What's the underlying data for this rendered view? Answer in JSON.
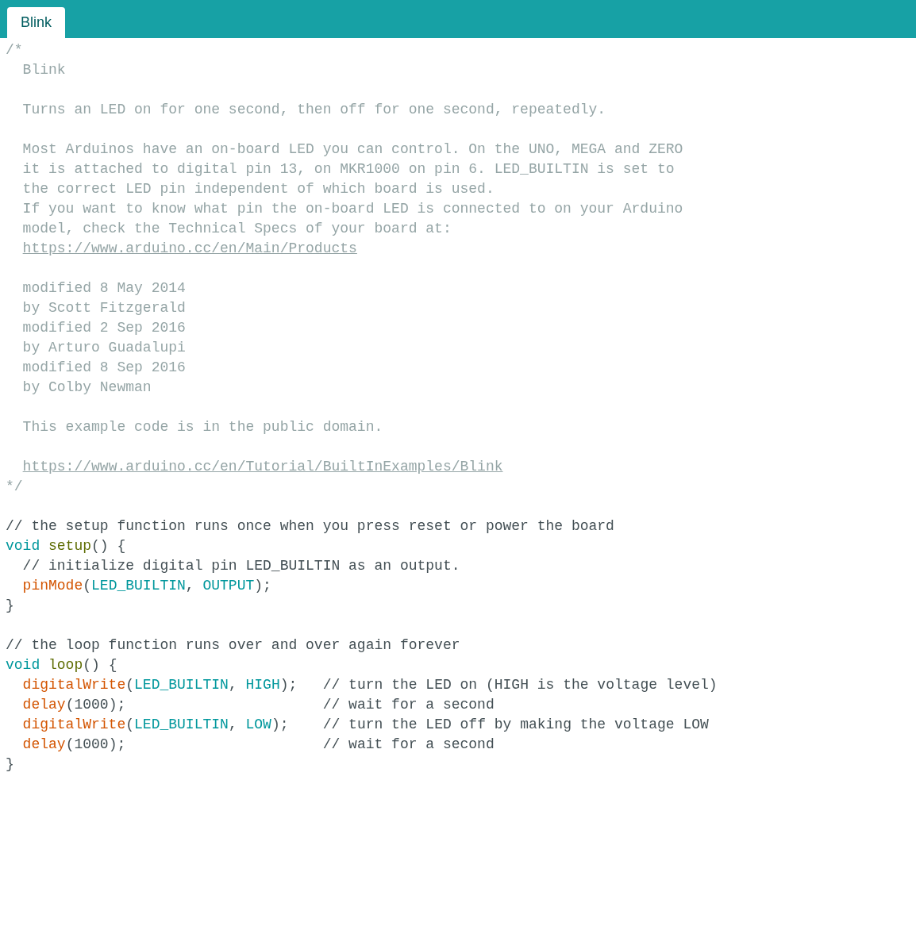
{
  "tabs": [
    {
      "label": "Blink",
      "selected": true
    }
  ],
  "editor": {
    "lines": [
      {
        "tokens": [
          {
            "kind": "block-comment",
            "text": "/*"
          }
        ]
      },
      {
        "tokens": [
          {
            "kind": "block-comment",
            "text": "  Blink"
          }
        ]
      },
      {
        "gap_before": true,
        "tokens": [
          {
            "kind": "block-comment",
            "text": "  Turns an LED on for one second, then off for one second, repeatedly."
          }
        ]
      },
      {
        "gap_before": true,
        "tokens": [
          {
            "kind": "block-comment",
            "text": "  Most Arduinos have an on-board LED you can control. On the UNO, MEGA and ZERO"
          }
        ]
      },
      {
        "tokens": [
          {
            "kind": "block-comment",
            "text": "  it is attached to digital pin 13, on MKR1000 on pin 6. LED_BUILTIN is set to"
          }
        ]
      },
      {
        "tokens": [
          {
            "kind": "block-comment",
            "text": "  the correct LED pin independent of which board is used."
          }
        ]
      },
      {
        "tokens": [
          {
            "kind": "block-comment",
            "text": "  If you want to know what pin the on-board LED is connected to on your Arduino"
          }
        ]
      },
      {
        "tokens": [
          {
            "kind": "block-comment",
            "text": "  model, check the Technical Specs of your board at:"
          }
        ]
      },
      {
        "tokens": [
          {
            "kind": "link",
            "text": "  https://www.arduino.cc/en/Main/Products"
          }
        ]
      },
      {
        "gap_before": true,
        "tokens": [
          {
            "kind": "block-comment",
            "text": "  modified 8 May 2014"
          }
        ]
      },
      {
        "tokens": [
          {
            "kind": "block-comment",
            "text": "  by Scott Fitzgerald"
          }
        ]
      },
      {
        "tokens": [
          {
            "kind": "block-comment",
            "text": "  modified 2 Sep 2016"
          }
        ]
      },
      {
        "tokens": [
          {
            "kind": "block-comment",
            "text": "  by Arturo Guadalupi"
          }
        ]
      },
      {
        "tokens": [
          {
            "kind": "block-comment",
            "text": "  modified 8 Sep 2016"
          }
        ]
      },
      {
        "tokens": [
          {
            "kind": "block-comment",
            "text": "  by Colby Newman"
          }
        ]
      },
      {
        "gap_before": true,
        "tokens": [
          {
            "kind": "block-comment",
            "text": "  This example code is in the public domain."
          }
        ]
      },
      {
        "gap_before": true,
        "tokens": [
          {
            "kind": "link",
            "text": "  https://www.arduino.cc/en/Tutorial/BuiltInExamples/Blink"
          }
        ]
      },
      {
        "tokens": [
          {
            "kind": "block-comment",
            "text": "*/"
          }
        ]
      },
      {
        "gap_before": true,
        "tokens": [
          {
            "kind": "line-comment",
            "text": "// the setup function runs once when you press reset or power the board"
          }
        ]
      },
      {
        "tokens": [
          {
            "kind": "keyword",
            "text": "void"
          },
          {
            "kind": "function",
            "text": " setup"
          },
          {
            "kind": "plain",
            "text": "() {"
          }
        ]
      },
      {
        "tokens": [
          {
            "kind": "line-comment",
            "text": "  // initialize digital pin LED_BUILTIN as an output."
          }
        ]
      },
      {
        "tokens": [
          {
            "kind": "builtin",
            "text": "  pinMode"
          },
          {
            "kind": "plain",
            "text": "("
          },
          {
            "kind": "constant",
            "text": "LED_BUILTIN"
          },
          {
            "kind": "plain",
            "text": ", "
          },
          {
            "kind": "constant",
            "text": "OUTPUT"
          },
          {
            "kind": "plain",
            "text": ");"
          }
        ]
      },
      {
        "tokens": [
          {
            "kind": "plain",
            "text": "}"
          }
        ]
      },
      {
        "gap_before": true,
        "tokens": [
          {
            "kind": "line-comment",
            "text": "// the loop function runs over and over again forever"
          }
        ]
      },
      {
        "tokens": [
          {
            "kind": "keyword",
            "text": "void"
          },
          {
            "kind": "function",
            "text": " loop"
          },
          {
            "kind": "plain",
            "text": "() {"
          }
        ]
      },
      {
        "tokens": [
          {
            "kind": "builtin",
            "text": "  digitalWrite"
          },
          {
            "kind": "plain",
            "text": "("
          },
          {
            "kind": "constant",
            "text": "LED_BUILTIN"
          },
          {
            "kind": "plain",
            "text": ", "
          },
          {
            "kind": "constant",
            "text": "HIGH"
          },
          {
            "kind": "plain",
            "text": ");"
          },
          {
            "kind": "line-comment",
            "text": "   // turn the LED on (HIGH is the voltage level)"
          }
        ]
      },
      {
        "tokens": [
          {
            "kind": "builtin",
            "text": "  delay"
          },
          {
            "kind": "plain",
            "text": "(1000);"
          },
          {
            "kind": "line-comment",
            "text": "                       // wait for a second"
          }
        ]
      },
      {
        "tokens": [
          {
            "kind": "builtin",
            "text": "  digitalWrite"
          },
          {
            "kind": "plain",
            "text": "("
          },
          {
            "kind": "constant",
            "text": "LED_BUILTIN"
          },
          {
            "kind": "plain",
            "text": ", "
          },
          {
            "kind": "constant",
            "text": "LOW"
          },
          {
            "kind": "plain",
            "text": ");"
          },
          {
            "kind": "line-comment",
            "text": "    // turn the LED off by making the voltage LOW"
          }
        ]
      },
      {
        "tokens": [
          {
            "kind": "builtin",
            "text": "  delay"
          },
          {
            "kind": "plain",
            "text": "(1000);"
          },
          {
            "kind": "line-comment",
            "text": "                       // wait for a second"
          }
        ]
      },
      {
        "tokens": [
          {
            "kind": "plain",
            "text": "}"
          }
        ]
      }
    ]
  }
}
